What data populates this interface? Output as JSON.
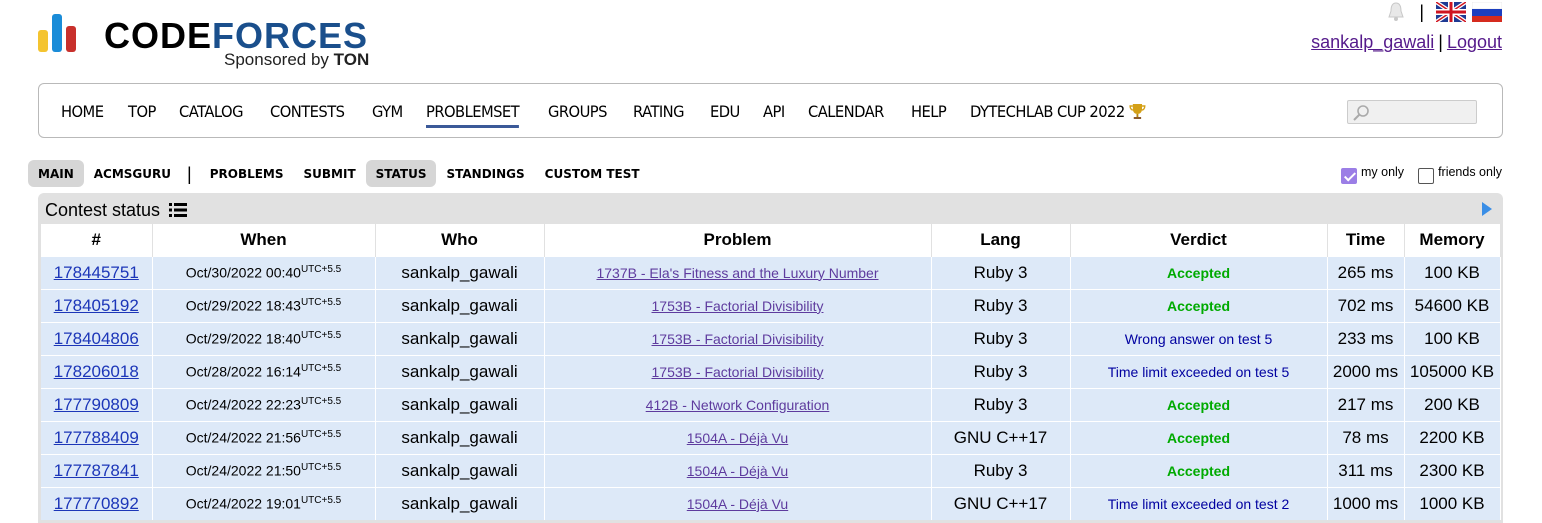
{
  "brand": {
    "word_a": "CODE",
    "word_b": "FORCES",
    "sponsor_prefix": "Sponsored by",
    "sponsor_name": "TON"
  },
  "header": {
    "username": "sankalp_gawali",
    "logout": "Logout",
    "separator": "|"
  },
  "main_menu": [
    {
      "label": "HOME"
    },
    {
      "label": "TOP"
    },
    {
      "label": "CATALOG"
    },
    {
      "label": "CONTESTS"
    },
    {
      "label": "GYM"
    },
    {
      "label": "PROBLEMSET",
      "active": true
    },
    {
      "label": "GROUPS"
    },
    {
      "label": "RATING"
    },
    {
      "label": "EDU"
    },
    {
      "label": "API"
    },
    {
      "label": "CALENDAR"
    },
    {
      "label": "HELP"
    },
    {
      "label": "DYTECHLAB CUP 2022"
    }
  ],
  "second_menu": {
    "main": "MAIN",
    "acmsguru": "ACMSGURU",
    "divider": "|",
    "problems": "PROBLEMS",
    "submit": "SUBMIT",
    "status": "STATUS",
    "standings": "STANDINGS",
    "custom_test": "CUSTOM TEST"
  },
  "filters": {
    "my_only": "my only",
    "friends_only": "friends only"
  },
  "panel": {
    "title": "Contest status"
  },
  "table": {
    "headers": [
      "#",
      "When",
      "Who",
      "Problem",
      "Lang",
      "Verdict",
      "Time",
      "Memory"
    ],
    "rows": [
      {
        "id": "178445751",
        "when": "Oct/30/2022 00:40",
        "tz": "UTC+5.5",
        "who": "sankalp_gawali",
        "problem": "1737B - Ela's Fitness and the Luxury Number",
        "lang": "Ruby 3",
        "verdict": "Accepted",
        "ok": true,
        "time": "265 ms",
        "memory": "100 KB"
      },
      {
        "id": "178405192",
        "when": "Oct/29/2022 18:43",
        "tz": "UTC+5.5",
        "who": "sankalp_gawali",
        "problem": "1753B - Factorial Divisibility",
        "lang": "Ruby 3",
        "verdict": "Accepted",
        "ok": true,
        "time": "702 ms",
        "memory": "54600 KB"
      },
      {
        "id": "178404806",
        "when": "Oct/29/2022 18:40",
        "tz": "UTC+5.5",
        "who": "sankalp_gawali",
        "problem": "1753B - Factorial Divisibility",
        "lang": "Ruby 3",
        "verdict": "Wrong answer on test 5",
        "ok": false,
        "time": "233 ms",
        "memory": "100 KB"
      },
      {
        "id": "178206018",
        "when": "Oct/28/2022 16:14",
        "tz": "UTC+5.5",
        "who": "sankalp_gawali",
        "problem": "1753B - Factorial Divisibility",
        "lang": "Ruby 3",
        "verdict": "Time limit exceeded on test 5",
        "ok": false,
        "time": "2000 ms",
        "memory": "105000 KB"
      },
      {
        "id": "177790809",
        "when": "Oct/24/2022 22:23",
        "tz": "UTC+5.5",
        "who": "sankalp_gawali",
        "problem": "412B - Network Configuration",
        "lang": "Ruby 3",
        "verdict": "Accepted",
        "ok": true,
        "time": "217 ms",
        "memory": "200 KB"
      },
      {
        "id": "177788409",
        "when": "Oct/24/2022 21:56",
        "tz": "UTC+5.5",
        "who": "sankalp_gawali",
        "problem": "1504A - Déjà Vu",
        "lang": "GNU C++17",
        "verdict": "Accepted",
        "ok": true,
        "time": "78 ms",
        "memory": "2200 KB"
      },
      {
        "id": "177787841",
        "when": "Oct/24/2022 21:50",
        "tz": "UTC+5.5",
        "who": "sankalp_gawali",
        "problem": "1504A - Déjà Vu",
        "lang": "Ruby 3",
        "verdict": "Accepted",
        "ok": true,
        "time": "311 ms",
        "memory": "2300 KB"
      },
      {
        "id": "177770892",
        "when": "Oct/24/2022 19:01",
        "tz": "UTC+5.5",
        "who": "sankalp_gawali",
        "problem": "1504A - Déjà Vu",
        "lang": "GNU C++17",
        "verdict": "Time limit exceeded on test 2",
        "ok": false,
        "time": "1000 ms",
        "memory": "1000 KB"
      }
    ]
  },
  "icons": {
    "bell": "bell-icon",
    "flag_en": "flag-uk-icon",
    "flag_ru": "flag-ru-icon",
    "search": "search-icon",
    "trophy": "trophy-icon",
    "list": "list-icon",
    "arrow": "arrow-right-icon"
  },
  "colors": {
    "accepted": "#00aa00",
    "rejected": "#0000a0",
    "row_bg": "#dde9f8",
    "id_link": "#1c36b8"
  }
}
